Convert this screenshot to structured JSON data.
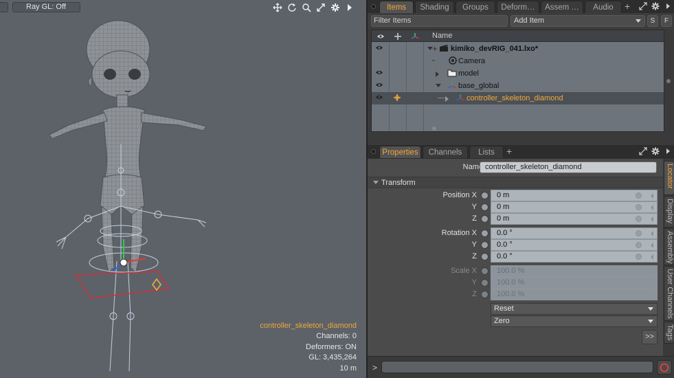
{
  "viewport": {
    "render_label": "Ray GL: Off",
    "info": {
      "selected_item": "controller_skeleton_diamond",
      "channels": "Channels: 0",
      "deformers": "Deformers: ON",
      "gl": "GL: 3,435,264",
      "grid": "10 m"
    },
    "tool_icons": [
      "move-view-icon",
      "rotate-view-icon",
      "zoom-view-icon",
      "fit-view-icon",
      "viewport-settings-icon",
      "viewport-menu-arrow-icon"
    ]
  },
  "items_panel": {
    "tabs": [
      {
        "label": "Items",
        "active": true
      },
      {
        "label": "Shading",
        "active": false
      },
      {
        "label": "Groups",
        "active": false
      },
      {
        "label": "Deform…",
        "active": false
      },
      {
        "label": "Assem …",
        "active": false
      },
      {
        "label": "Audio",
        "active": false
      }
    ],
    "filter_placeholder": "Filter Items",
    "add_item_label": "Add Item",
    "s_button": "S",
    "f_button": "F",
    "name_header": "Name",
    "tree": [
      {
        "label": "kimiko_devRIG_041.lxo*",
        "bold": true,
        "visible": true
      },
      {
        "label": "Camera",
        "bold": false,
        "visible": false
      },
      {
        "label": "model",
        "bold": false,
        "visible": true
      },
      {
        "label": "base_global",
        "bold": false,
        "visible": true
      },
      {
        "label": "controller_skeleton_diamond",
        "bold": false,
        "visible": true,
        "selected": true
      }
    ]
  },
  "properties_panel": {
    "tabs": [
      {
        "label": "Properties",
        "active": true
      },
      {
        "label": "Channels",
        "active": false
      },
      {
        "label": "Lists",
        "active": false
      }
    ],
    "name_label": "Name",
    "name_value": "controller_skeleton_diamond",
    "section_title": "Transform",
    "fields": [
      {
        "label": "Position X",
        "value": "0 m"
      },
      {
        "label": "Y",
        "value": "0 m"
      },
      {
        "label": "Z",
        "value": "0 m"
      },
      {
        "label": "Rotation X",
        "value": "0.0 °"
      },
      {
        "label": "Y",
        "value": "0.0 °"
      },
      {
        "label": "Z",
        "value": "0.0 °"
      },
      {
        "label": "Scale X",
        "value": "100.0 %"
      },
      {
        "label": "Y",
        "value": "100.0 %"
      },
      {
        "label": "Z",
        "value": "100.0 %"
      }
    ],
    "reset_label": "Reset",
    "zero_label": "Zero",
    "more_label": ">>",
    "side_tabs": [
      "Locator",
      "Display",
      "Assembly",
      "User Channels",
      "Tags"
    ]
  },
  "command": {
    "prompt": ">"
  },
  "colors": {
    "accent": "#f3a83b",
    "viewport_bg": "#5d6269",
    "tree_bg": "#6d747c"
  }
}
